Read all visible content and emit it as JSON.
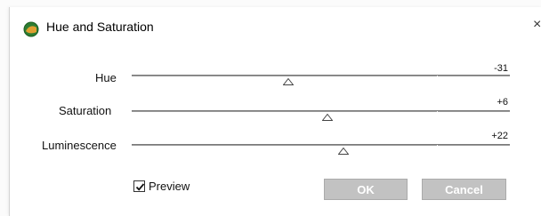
{
  "window": {
    "title": "Hue and Saturation",
    "close_glyph": "×"
  },
  "sliders": [
    {
      "label": "Hue",
      "value_text": "-31",
      "value": -31
    },
    {
      "label": "Saturation",
      "value_text": "+6",
      "value": 6
    },
    {
      "label": "Luminescence",
      "value_text": "+22",
      "value": 22
    }
  ],
  "slider_range": [
    -180,
    180
  ],
  "preview": {
    "label": "Preview",
    "checked": true
  },
  "buttons": {
    "ok": "OK",
    "cancel": "Cancel"
  },
  "colors": {
    "button_disabled_bg": "#c2c2c2",
    "track": "#9a9a9a"
  }
}
